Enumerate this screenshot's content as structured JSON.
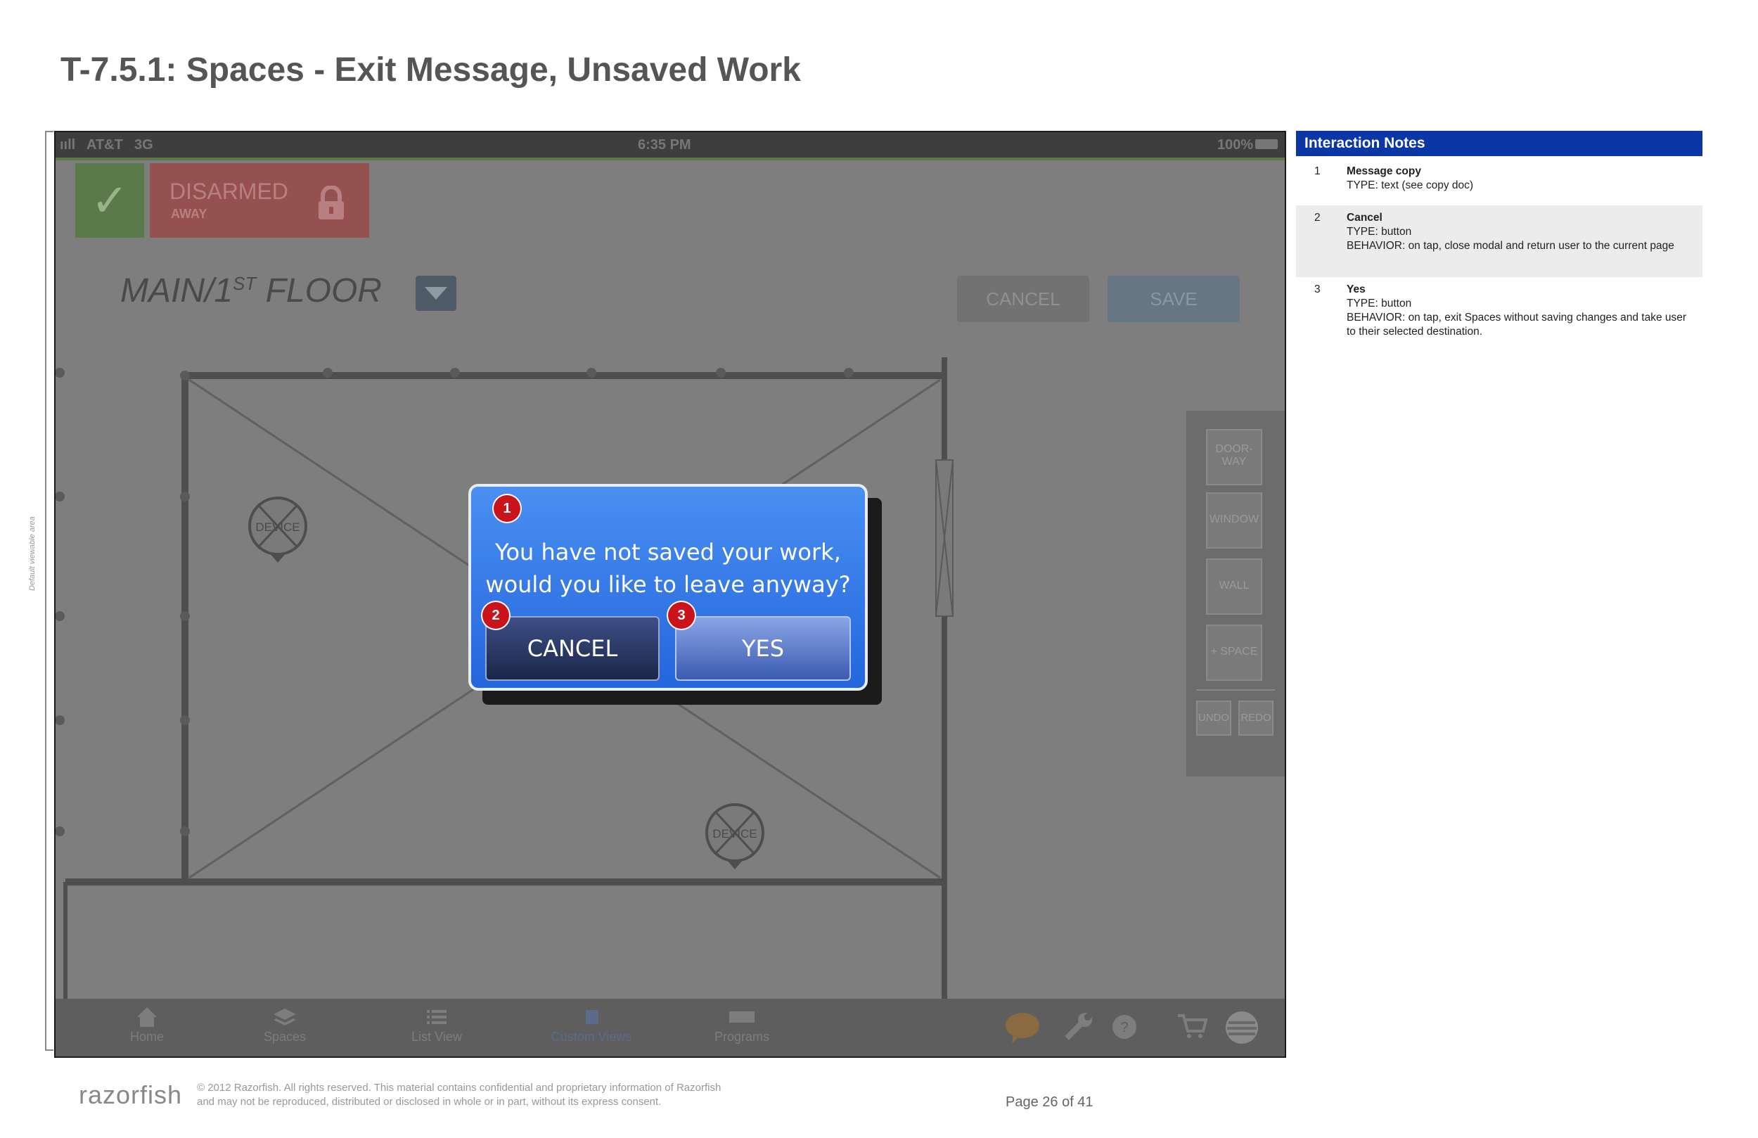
{
  "page": {
    "title": "T-7.5.1: Spaces - Exit Message, Unsaved Work",
    "viewable_area_label": "Default viewable area"
  },
  "device": {
    "status_bar": {
      "carrier": "AT&T",
      "network": "3G",
      "time": "6:35 PM",
      "battery": "100%"
    },
    "alarm": {
      "status": "DISARMED",
      "mode": "AWAY"
    },
    "floor": {
      "name_prefix": "MAIN/1",
      "superscript": "ST",
      "name_suffix": " FLOOR"
    },
    "actions": {
      "cancel_label": "CANCEL",
      "save_label": "SAVE"
    },
    "floorplan": {
      "device_label_1": "DEVICE",
      "device_label_2": "DEVICE"
    },
    "tools": {
      "doorway_line1": "DOOR-",
      "doorway_line2": "WAY",
      "window": "WINDOW",
      "wall": "WALL",
      "space": "+ SPACE",
      "undo": "UNDO",
      "redo": "REDO"
    },
    "nav": {
      "items": [
        {
          "label": "Home"
        },
        {
          "label": "Spaces"
        },
        {
          "label": "List View"
        },
        {
          "label": "Custom Views"
        },
        {
          "label": "Programs"
        }
      ],
      "icons": [
        "chat-icon",
        "wrench-icon",
        "help-icon",
        "cart-icon",
        "att-logo-icon"
      ]
    }
  },
  "modal": {
    "message_line1": "You have not saved your work,",
    "message_line2": "would you like to leave anyway?",
    "cancel_label": "CANCEL",
    "yes_label": "YES",
    "markers": [
      "1",
      "2",
      "3"
    ]
  },
  "notes": {
    "header": "Interaction Notes",
    "items": [
      {
        "num": "1",
        "title": "Message copy",
        "lines": [
          "TYPE: text (see copy doc)"
        ]
      },
      {
        "num": "2",
        "title": "Cancel",
        "lines": [
          "TYPE: button",
          "BEHAVIOR: on tap, close modal and return user to the current page"
        ]
      },
      {
        "num": "3",
        "title": "Yes",
        "lines": [
          "TYPE: button",
          "BEHAVIOR: on tap, exit Spaces without saving changes and take user to their selected destination."
        ]
      }
    ]
  },
  "footer": {
    "logo": "razorfish",
    "copyright_line1": "© 2012 Razorfish. All rights reserved. This material contains confidential and proprietary information of Razorfish",
    "copyright_line2": "and may not be reproduced, distributed or disclosed in whole or in part, without its express consent.",
    "page_number": "Page  26 of 41"
  },
  "colors": {
    "modal_blue": "#2f74e6",
    "marker_red": "#c8141a",
    "notes_header_blue": "#0a37a5",
    "alarm_green": "#5b7a4a",
    "alarm_red": "#955050"
  }
}
